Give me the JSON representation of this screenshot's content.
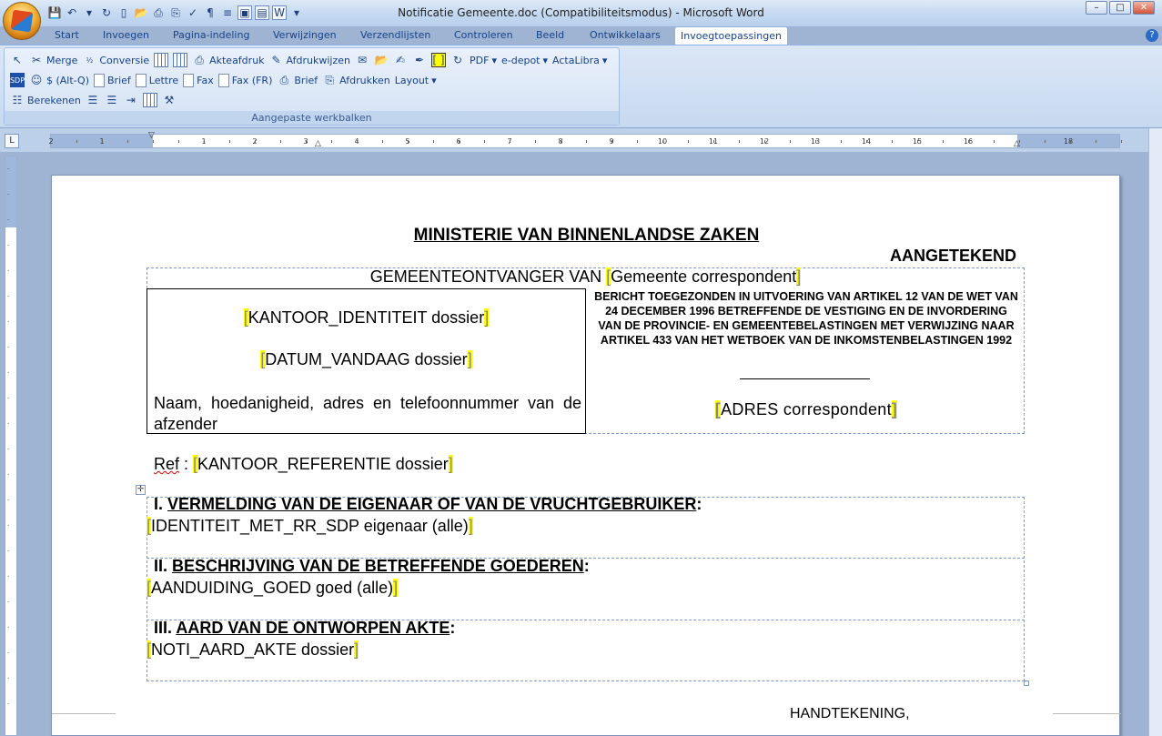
{
  "window": {
    "title": "Notificatie Gemeente.doc (Compatibiliteitsmodus) - Microsoft Word"
  },
  "tabs": [
    "Start",
    "Invoegen",
    "Pagina-indeling",
    "Verwijzingen",
    "Verzendlijsten",
    "Controleren",
    "Beeld",
    "Ontwikkelaars",
    "Invoegtoepassingen"
  ],
  "active_tab": "Invoegtoepassingen",
  "ribbon": {
    "group_label": "Aangepaste werkbalken",
    "row1": {
      "merge": "Merge",
      "conversie": "Conversie",
      "akteafdruk": "Akteafdruk",
      "afdrukwijzen": "Afdrukwijzen",
      "pdf": "PDF",
      "edepot": "e-depot",
      "actalibra": "ActaLibra"
    },
    "row2": {
      "altq": "$ (Alt-Q)",
      "brief": "Brief",
      "lettre": "Lettre",
      "fax": "Fax",
      "faxfr": "Fax (FR)",
      "brief2": "Brief",
      "afdrukken": "Afdrukken",
      "layout": "Layout"
    },
    "row3": {
      "berekenen": "Berekenen"
    }
  },
  "ruler": {
    "labels": [
      "2",
      "1",
      "1",
      "2",
      "3",
      "4",
      "5",
      "6",
      "7",
      "8",
      "9",
      "10",
      "11",
      "12",
      "13",
      "14",
      "15",
      "16",
      "18"
    ]
  },
  "document": {
    "heading": "MINISTERIE VAN BINNENLANDSE  ZAKEN",
    "aangetekend": "AANGETEKEND",
    "gemeente_prefix": "GEMEENTEONTVANGER VAN ",
    "gemeente_field": "Gemeente correspondent",
    "kantoor_identiteit": "KANTOOR_IDENTITEIT dossier",
    "datum_vandaag": "DATUM_VANDAAG dossier",
    "afzender": "Naam, hoedanigheid, adres en telefoonnummer van de afzender",
    "bericht": "BERICHT TOEGEZONDEN IN UITVOERING VAN ARTIKEL 12 VAN DE WET VAN 24 DECEMBER 1996 BETREFFENDE DE VESTIGING EN DE INVORDERING VAN DE PROVINCIE- EN GEMEENTEBELASTINGEN MET VERWIJZING NAAR ARTIKEL 433 VAN HET WETBOEK VAN DE INKOMSTENBELASTINGEN 1992",
    "adres": "ADRES correspondent",
    "ref_label": "Ref",
    "ref_colon": " : ",
    "ref_field": "KANTOOR_REFERENTIE dossier",
    "section1_num": "I. ",
    "section1_title": "VERMELDING VAN DE EIGENAAR  OF VAN DE VRUCHTGEBRUIKER",
    "section1_field": "IDENTITEIT_MET_RR_SDP eigenaar (alle)",
    "section2_num": "II. ",
    "section2_title": "BESCHRIJVING VAN DE BETREFFENDE GOEDEREN",
    "section2_field": "AANDUIDING_GOED goed (alle)",
    "section3_num": "III. ",
    "section3_title": "AARD VAN DE ONTWORPEN AKTE",
    "section3_field": "NOTI_AARD_AKTE dossier",
    "colon": ":",
    "handtekening": "HANDTEKENING,"
  }
}
